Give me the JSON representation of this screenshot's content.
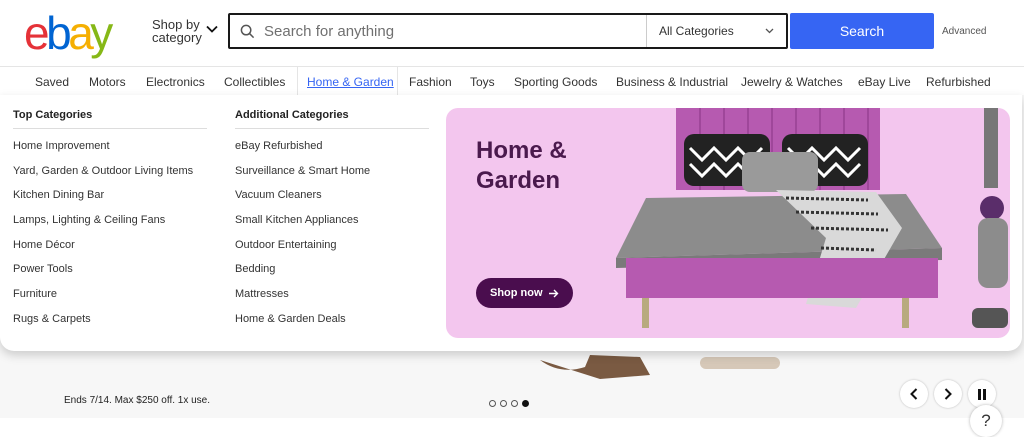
{
  "header": {
    "logo_letters": [
      "e",
      "b",
      "a",
      "y"
    ],
    "logo_colors": [
      "#e53238",
      "#0064d2",
      "#f5af02",
      "#86b817"
    ],
    "shop_by_line1": "Shop by",
    "shop_by_line2": "category",
    "search_placeholder": "Search for anything",
    "category_select": "All Categories",
    "search_button": "Search",
    "advanced": "Advanced",
    "accent_color": "#3665f3"
  },
  "nav": {
    "items": [
      "Saved",
      "Motors",
      "Electronics",
      "Collectibles",
      "Home & Garden",
      "Fashion",
      "Toys",
      "Sporting Goods",
      "Business & Industrial",
      "Jewelry & Watches",
      "eBay Live",
      "Refurbished"
    ],
    "active": "Home & Garden"
  },
  "dropdown": {
    "top_categories": {
      "heading": "Top Categories",
      "items": [
        "Home Improvement",
        "Yard, Garden & Outdoor Living Items",
        "Kitchen Dining Bar",
        "Lamps, Lighting & Ceiling Fans",
        "Home Décor",
        "Power Tools",
        "Furniture",
        "Rugs & Carpets"
      ]
    },
    "additional_categories": {
      "heading": "Additional Categories",
      "items": [
        "eBay Refurbished",
        "Surveillance & Smart Home",
        "Vacuum Cleaners",
        "Small Kitchen Appliances",
        "Outdoor Entertaining",
        "Bedding",
        "Mattresses",
        "Home & Garden Deals"
      ]
    },
    "promo": {
      "title_line1": "Home &",
      "title_line2": "Garden",
      "button": "Shop now",
      "button_icon": "arrow-right-icon",
      "background_color": "#f3c6ee",
      "button_color": "#4a0d4e"
    }
  },
  "hero": {
    "legal_text": "Ends 7/14. Max $250 off. 1x use.",
    "carousel_dots": 4,
    "carousel_active": 4,
    "help": "?"
  }
}
